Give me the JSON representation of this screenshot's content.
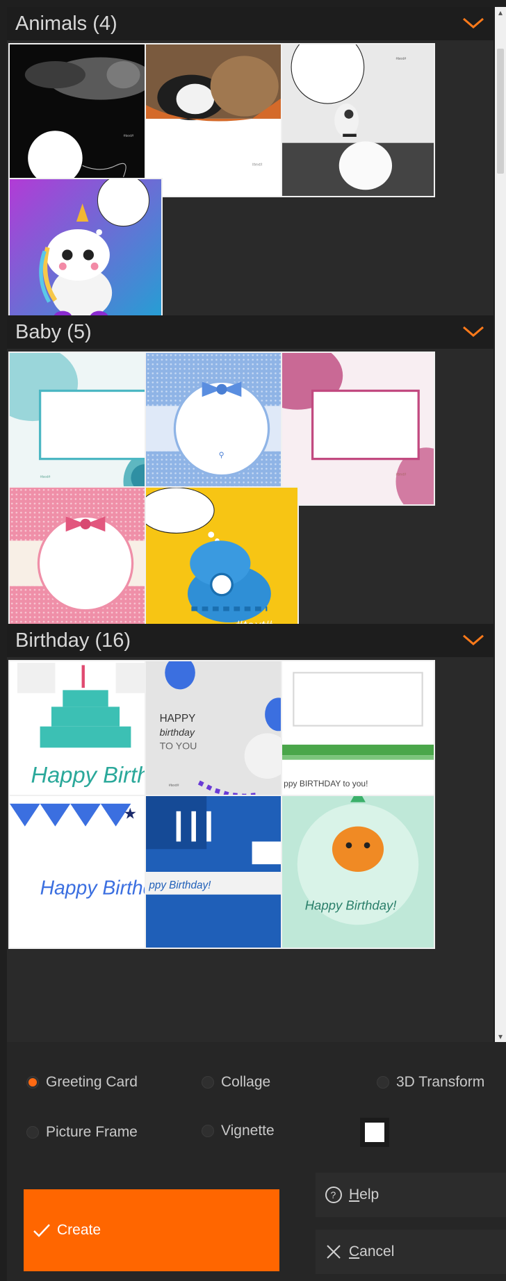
{
  "sections": [
    {
      "title": "Animals (4)"
    },
    {
      "title": "Baby (5)"
    },
    {
      "title": "Birthday (16)"
    }
  ],
  "card_text": {
    "placeholder": "#text#",
    "happy": "HAPPY",
    "birthday_script": "birthday",
    "to_you": "TO YOU",
    "happy_birthday_script": "Happy Birthday",
    "birthday_to_you": "ppy BIRTHDAY to you!",
    "birthday_bang": "ppy Birthday!",
    "happy_birthday_round": "Happy Birthday!"
  },
  "options": {
    "greeting_card": "Greeting Card",
    "collage": "Collage",
    "transform_3d": "3D Transform",
    "picture_frame": "Picture Frame",
    "vignette": "Vignette",
    "selected": "greeting_card",
    "frame_color": "#ffffff"
  },
  "buttons": {
    "create": "Create",
    "help_prefix": "",
    "help_mnemonic": "H",
    "help_rest": "elp",
    "cancel_mnemonic": "C",
    "cancel_rest": "ancel"
  },
  "colors": {
    "accent": "#ff6600",
    "chevron": "#ff7a1a"
  }
}
